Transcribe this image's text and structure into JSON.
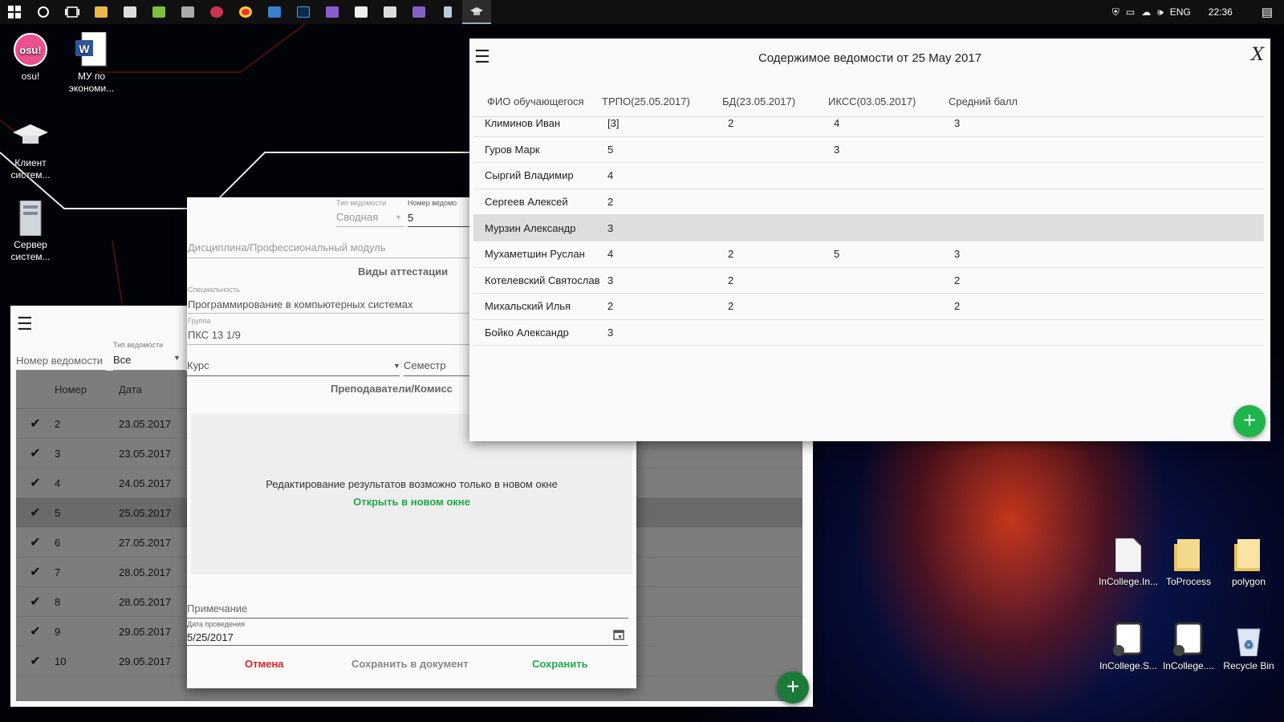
{
  "taskbar": {
    "language": "ENG",
    "clock": "22:36"
  },
  "desktop_icons": [
    {
      "label": "osu!",
      "icon": "osu-icon"
    },
    {
      "label": "МУ по экономи...",
      "icon": "word-document-icon"
    },
    {
      "label": "Клиент систем...",
      "icon": "graduation-cap-icon"
    },
    {
      "label": "Сервер систем...",
      "icon": "server-icon"
    },
    {
      "label": "InCollege.In...",
      "icon": "file-icon"
    },
    {
      "label": "ToProcess",
      "icon": "folder-icon"
    },
    {
      "label": "polygon",
      "icon": "folder-icon"
    },
    {
      "label": "InCollege.S...",
      "icon": "incollege-icon"
    },
    {
      "label": "InCollege....",
      "icon": "incollege-icon"
    },
    {
      "label": "Recycle Bin",
      "icon": "recycle-bin-icon"
    }
  ],
  "list_window": {
    "number_label": "Номер ведомости",
    "type_label": "Тип ведомости",
    "type_value": "Все",
    "columns": [
      "Номер",
      "Дата"
    ],
    "rows": [
      {
        "number": "2",
        "date": "23.05.2017"
      },
      {
        "number": "3",
        "date": "23.05.2017"
      },
      {
        "number": "4",
        "date": "24.05.2017"
      },
      {
        "number": "5",
        "date": "25.05.2017"
      },
      {
        "number": "6",
        "date": "27.05.2017"
      },
      {
        "number": "7",
        "date": "28.05.2017"
      },
      {
        "number": "8",
        "date": "28.05.2017"
      },
      {
        "number": "9",
        "date": "29.05.2017"
      },
      {
        "number": "10",
        "date": "29.05.2017"
      }
    ],
    "selected_row": 3,
    "fab_label": "+"
  },
  "form_window": {
    "type_label": "Тип ведомости",
    "type_value": "Сводная",
    "number_label": "Номер ведомо",
    "number_value": "5",
    "discipline_placeholder": "Дисциплина/Профессиональный модуль",
    "attestation_header": "Виды аттестации",
    "specialty_label": "Специальность",
    "specialty_value": "Программирование в компьютерных системах",
    "group_label": "Группа",
    "group_value": "ПКС 13 1/9",
    "course_placeholder": "Курс",
    "semester_placeholder": "Семестр",
    "teachers_header": "Преподаватели/Комисс",
    "edit_notice": "Редактирование результатов возможно только в новом окне",
    "open_new_window": "Открыть в новом окне",
    "note_placeholder": "Примечание",
    "date_label": "Дата проведения",
    "date_value": "5/25/2017",
    "cancel": "Отмена",
    "save_to_doc": "Сохранить в документ",
    "save": "Сохранить",
    "colors": {
      "cancel": "#e02020",
      "save": "#1faa4a",
      "link": "#1faa4a"
    }
  },
  "content_window": {
    "title": "Содержимое ведомости от 25 May 2017",
    "close": "X",
    "columns": [
      "ФИО обучающегося",
      "ТРПО(25.05.2017)",
      "БД(23.05.2017)",
      "ИКСС(03.05.2017)",
      "Средний балл"
    ],
    "rows": [
      {
        "name": "Климинов Иван",
        "a": "[3]",
        "b": "2",
        "c": "4",
        "d": "3"
      },
      {
        "name": "Гуров Марк",
        "a": "5",
        "b": "",
        "c": "3",
        "d": ""
      },
      {
        "name": "Сыргий Владимир",
        "a": "4",
        "b": "",
        "c": "",
        "d": ""
      },
      {
        "name": "Сергеев Алексей",
        "a": "2",
        "b": "",
        "c": "",
        "d": ""
      },
      {
        "name": "Мурзин Александр",
        "a": "3",
        "b": "",
        "c": "",
        "d": ""
      },
      {
        "name": "Мухаметшин Руслан",
        "a": "4",
        "b": "2",
        "c": "5",
        "d": "3"
      },
      {
        "name": "Котелевский Святослав",
        "a": "3",
        "b": "2",
        "c": "",
        "d": "2"
      },
      {
        "name": "Михальский Илья",
        "a": "2",
        "b": "2",
        "c": "",
        "d": "2"
      },
      {
        "name": "Бойко Александр",
        "a": "3",
        "b": "",
        "c": "",
        "d": ""
      }
    ],
    "selected_row": 4,
    "fab_label": "+"
  }
}
